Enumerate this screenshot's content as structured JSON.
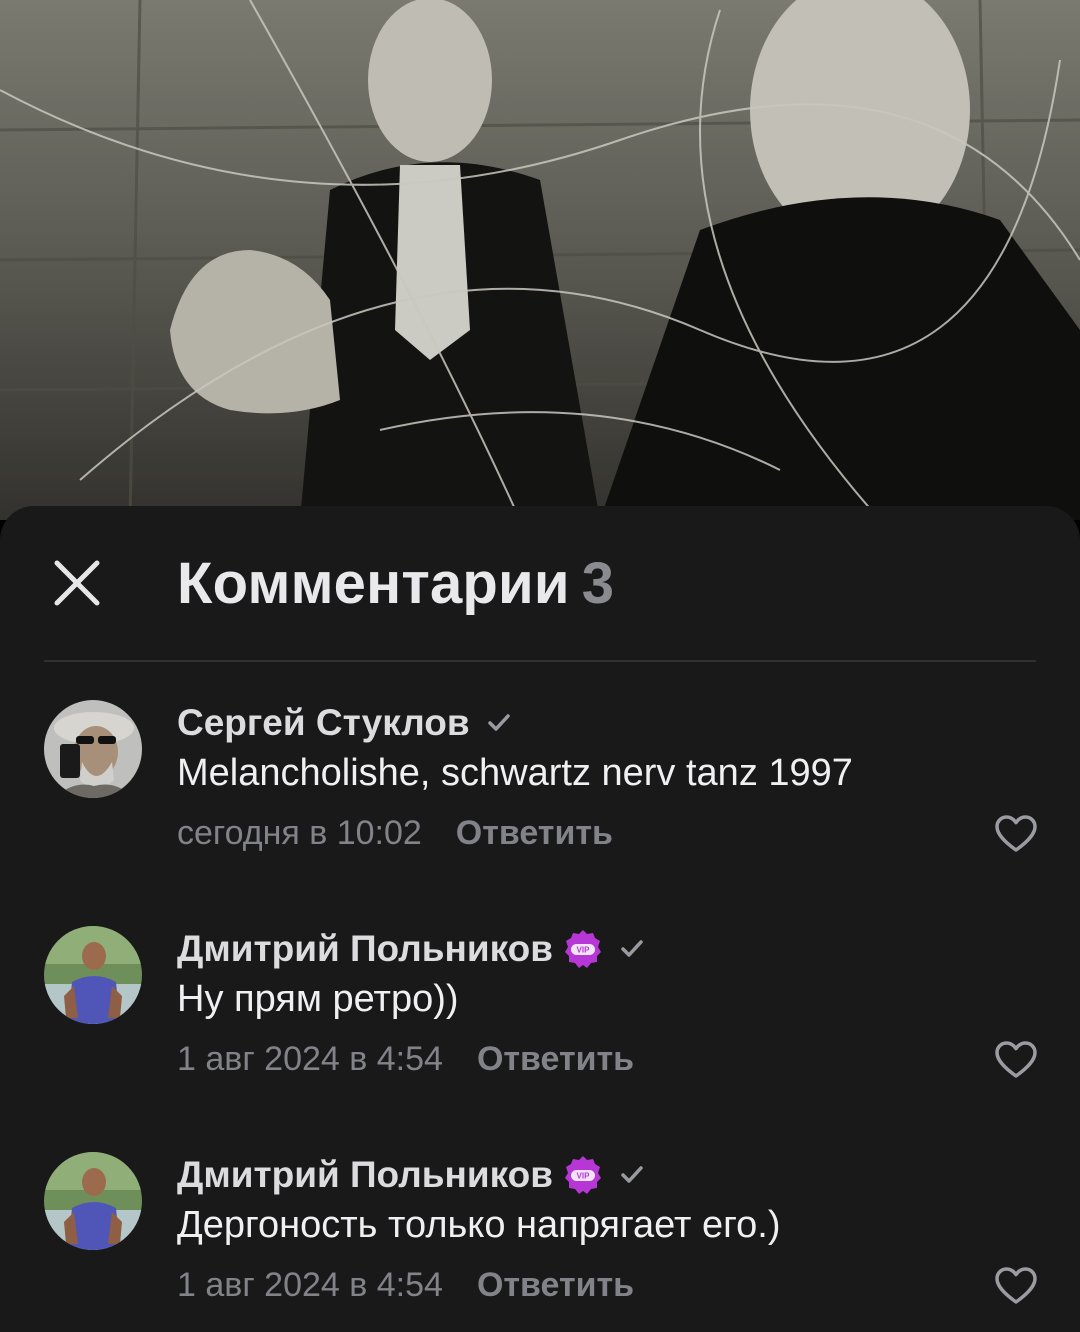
{
  "sheet": {
    "title": "Комментарии",
    "count": "3"
  },
  "comments": [
    {
      "author": "Сергей Стуклов",
      "vip": false,
      "verified": true,
      "text": "Melancholishe, schwartz nerv tanz 1997",
      "date": "сегодня в 10:02",
      "reply_label": "Ответить"
    },
    {
      "author": "Дмитрий Польников",
      "vip": true,
      "verified": true,
      "text": "Ну прям ретро))",
      "date": "1 авг 2024 в 4:54",
      "reply_label": "Ответить"
    },
    {
      "author": "Дмитрий Польников",
      "vip": true,
      "verified": true,
      "text": "Дергоность только напрягает его.)",
      "date": "1 авг 2024 в 4:54",
      "reply_label": "Ответить"
    }
  ],
  "colors": {
    "sheet_background": "#19191a",
    "text_primary": "#f0f0f2",
    "text_secondary": "#828388",
    "vip_badge": "#b636d6"
  },
  "icons": {
    "close": "close-icon",
    "verified": "checkmark-icon",
    "vip": "vip-badge-icon",
    "like": "heart-outline-icon"
  }
}
